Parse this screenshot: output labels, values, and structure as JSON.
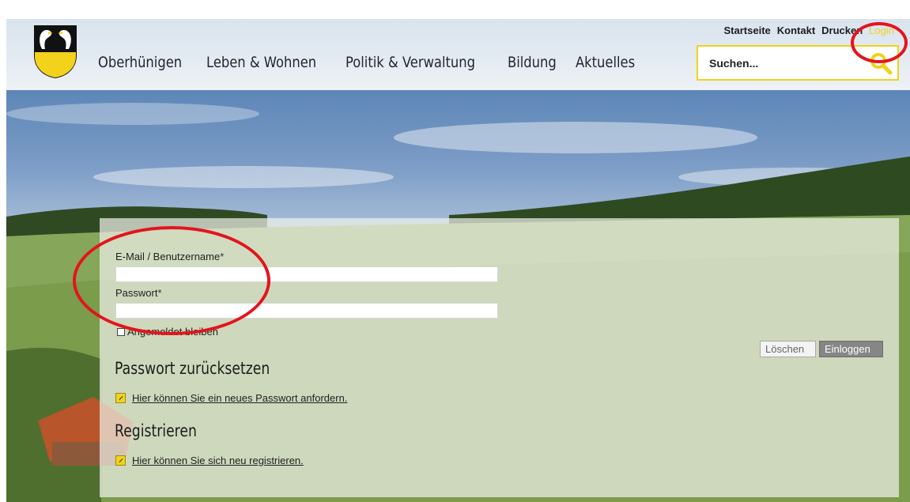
{
  "header": {
    "main_nav": [
      "Oberhünigen",
      "Leben & Wohnen",
      "Politik & Verwaltung",
      "Bildung",
      "Aktuelles"
    ],
    "top_links": {
      "home": "Startseite",
      "contact": "Kontakt",
      "print": "Drucken",
      "login": "Login"
    },
    "search": {
      "placeholder": "Suchen..."
    }
  },
  "login_form": {
    "username_label": "E-Mail / Benutzername",
    "password_label": "Passwort",
    "required_marker": "*",
    "remember_label": "Angemeldet bleiben",
    "clear_button": "Löschen",
    "submit_button": "Einloggen"
  },
  "reset": {
    "title": "Passwort zurücksetzen",
    "link": "Hier können Sie ein neues Passwort anfordern."
  },
  "register": {
    "title": "Registrieren",
    "link": "Hier können Sie sich neu registrieren."
  },
  "colors": {
    "accent_yellow": "#f2d21b",
    "annotation_red": "#e3141e",
    "login_button": "#868686"
  }
}
